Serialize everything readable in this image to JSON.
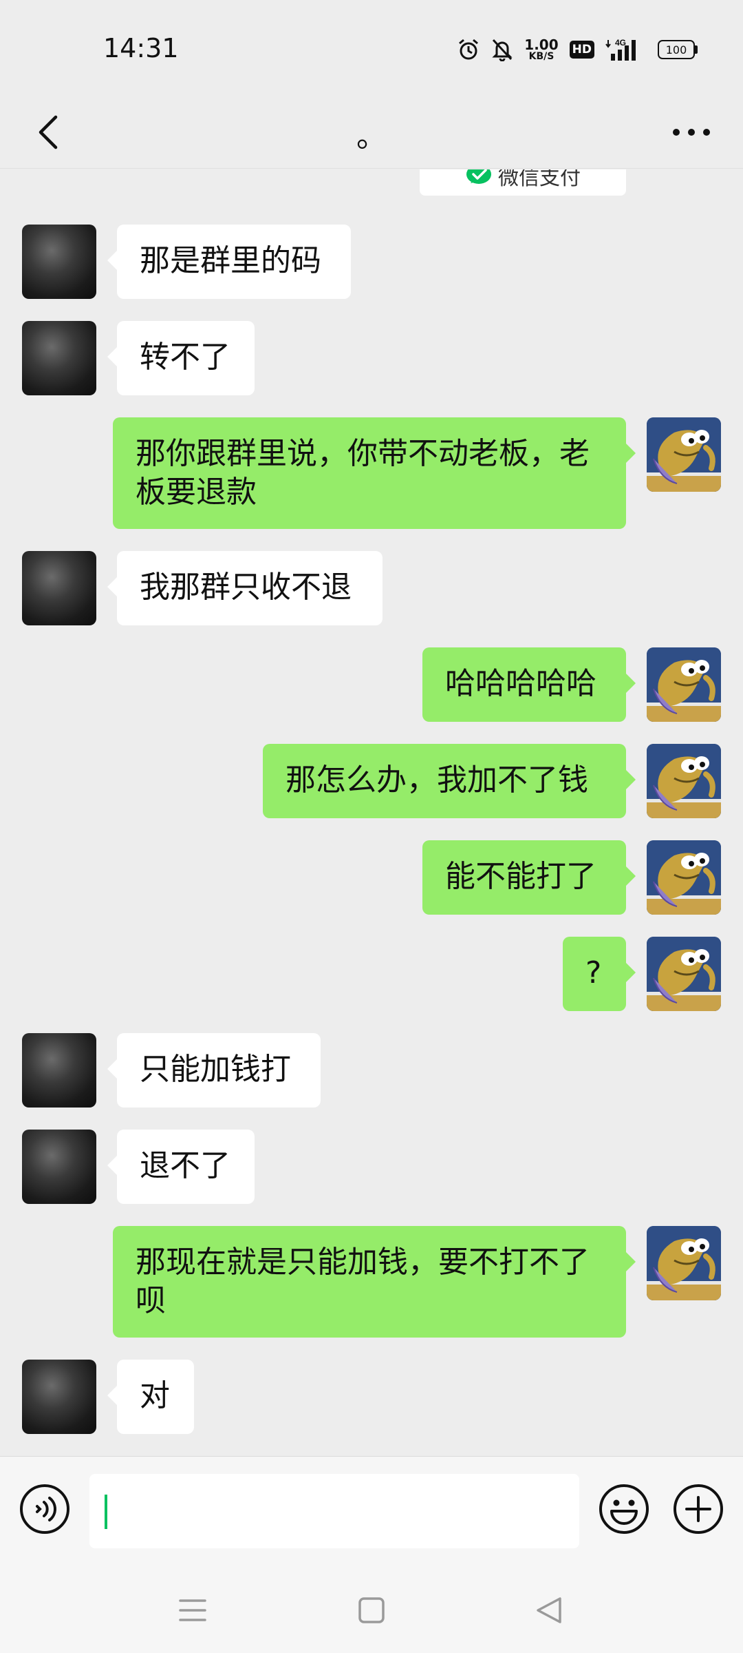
{
  "status_bar": {
    "time": "14:31",
    "net_speed_value": "1.00",
    "net_speed_unit": "KB/S",
    "hd_label": "HD",
    "network_label": "4G",
    "battery": "100"
  },
  "header": {
    "title": "。"
  },
  "pay_card": {
    "label": "微信支付",
    "accent": "#07c160"
  },
  "colors": {
    "background": "#ededed",
    "bubble_in": "#ffffff",
    "bubble_out": "#95ec69"
  },
  "messages": [
    {
      "side": "in",
      "text": "那是群里的码"
    },
    {
      "side": "in",
      "text": "转不了"
    },
    {
      "side": "out",
      "text": "那你跟群里说，你带不动老板，老板要退款"
    },
    {
      "side": "in",
      "text": "我那群只收不退"
    },
    {
      "side": "out",
      "text": "哈哈哈哈哈"
    },
    {
      "side": "out",
      "text": "那怎么办，我加不了钱"
    },
    {
      "side": "out",
      "text": "能不能打了"
    },
    {
      "side": "out",
      "text": "?"
    },
    {
      "side": "in",
      "text": "只能加钱打"
    },
    {
      "side": "in",
      "text": "退不了"
    },
    {
      "side": "out",
      "text": "那现在就是只能加钱，要不打不了呗"
    },
    {
      "side": "in",
      "text": "对"
    }
  ],
  "input_bar": {
    "voice_icon": "voice-icon",
    "emoji_icon": "emoji-icon",
    "plus_icon": "plus-icon"
  },
  "nav_bar": {
    "icons": [
      "menu-icon",
      "home-square-icon",
      "back-triangle-icon"
    ]
  }
}
